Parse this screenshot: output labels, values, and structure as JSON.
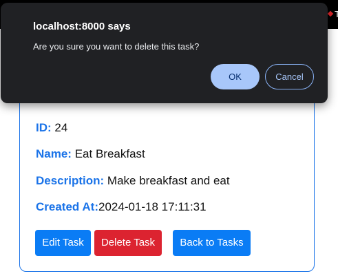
{
  "browser": {
    "app_icon": "yellow-app-icon",
    "truncated_tab_text": "T"
  },
  "dialog": {
    "title": "localhost:8000 says",
    "message": "Are you sure you want to delete this task?",
    "ok_label": "OK",
    "cancel_label": "Cancel"
  },
  "task": {
    "id_label": "ID:",
    "id_value": "24",
    "name_label": "Name:",
    "name_value": "Eat Breakfast",
    "description_label": "Description:",
    "description_value": "Make breakfast and eat",
    "created_label": "Created At:",
    "created_value": "2024-01-18 17:11:31"
  },
  "actions": {
    "edit_label": "Edit Task",
    "delete_label": "Delete Task",
    "back_label": "Back to Tasks"
  },
  "colors": {
    "accent_blue": "#0a7cf5",
    "label_blue": "#1a73e8",
    "danger_red": "#dc2330",
    "dialog_bg": "#202124",
    "dialog_ok_bg": "#a8c7fa"
  }
}
